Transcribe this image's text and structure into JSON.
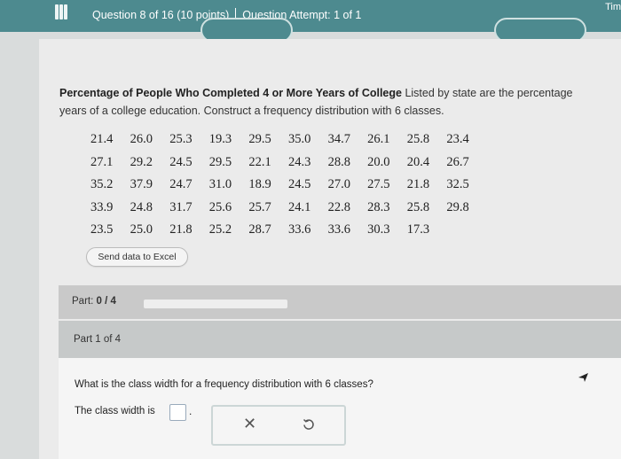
{
  "header": {
    "question_label": "Question 8 of 16 (10 points)",
    "attempt_label": "Question Attempt: 1 of 1",
    "timer_label": "Tim"
  },
  "problem": {
    "title": "Percentage of People Who Completed 4 or More Years of College",
    "text_line1": "Listed by state are the percentage",
    "text_line2": "years of a college education. Construct a frequency distribution with 6 classes.",
    "data_rows": [
      [
        "21.4",
        "26.0",
        "25.3",
        "19.3",
        "29.5",
        "35.0",
        "34.7",
        "26.1",
        "25.8",
        "23.4"
      ],
      [
        "27.1",
        "29.2",
        "24.5",
        "29.5",
        "22.1",
        "24.3",
        "28.8",
        "20.0",
        "20.4",
        "26.7"
      ],
      [
        "35.2",
        "37.9",
        "24.7",
        "31.0",
        "18.9",
        "24.5",
        "27.0",
        "27.5",
        "21.8",
        "32.5"
      ],
      [
        "33.9",
        "24.8",
        "31.7",
        "25.6",
        "25.7",
        "24.1",
        "22.8",
        "28.3",
        "25.8",
        "29.8"
      ],
      [
        "23.5",
        "25.0",
        "21.8",
        "25.2",
        "28.7",
        "33.6",
        "33.6",
        "30.3",
        "17.3"
      ]
    ],
    "excel_button": "Send data to Excel"
  },
  "part": {
    "prefix": "Part:",
    "value": "0 / 4",
    "progress": 0,
    "sub_label": "Part 1 of 4"
  },
  "question": {
    "text": "What is the class width for a frequency distribution with 6 classes?",
    "answer_label": "The class width is",
    "answer_value": "",
    "suffix": "."
  },
  "icons": {
    "clear": "close-icon",
    "undo": "undo-icon"
  },
  "colors": {
    "header_bg": "#4d8a8f",
    "panel_bg": "#ebebeb"
  }
}
